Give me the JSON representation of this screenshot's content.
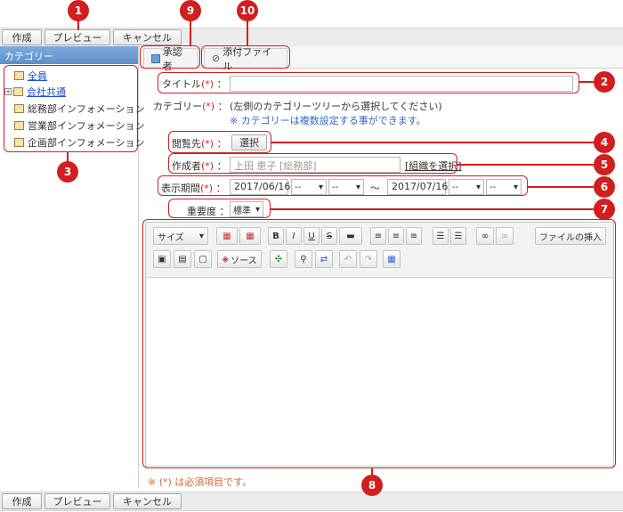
{
  "toolbar": {
    "create_label": "作成",
    "preview_label": "プレビュー",
    "cancel_label": "キャンセル"
  },
  "sidebar": {
    "header": "カテゴリー",
    "items": [
      {
        "label": "全員",
        "link": true,
        "expandable": false
      },
      {
        "label": "会社共通",
        "link": true,
        "expandable": true
      },
      {
        "label": "総務部インフォメーション",
        "link": false,
        "expandable": false
      },
      {
        "label": "営業部インフォメーション",
        "link": false,
        "expandable": false
      },
      {
        "label": "企画部インフォメーション",
        "link": false,
        "expandable": false
      }
    ]
  },
  "tabs": [
    {
      "label": "承認者"
    },
    {
      "label": "添付ファイル"
    }
  ],
  "form": {
    "required_mark": "(*)",
    "colon": "：",
    "title_label": "タイトル",
    "title_value": "",
    "category_label": "カテゴリー",
    "category_value": "(左側のカテゴリーツリーから選択してください)",
    "category_hint": "※ カテゴリーは複数設定する事ができます。",
    "viewers_label": "閲覧先",
    "viewers_button": "選択",
    "author_label": "作成者",
    "author_value": "上田 恵子 [総務部]",
    "author_link": "[組織を選択]",
    "period_label": "表示期間",
    "start_date": "2017/06/16",
    "end_date": "2017/07/16",
    "time_placeholder": "--",
    "period_sep": "～",
    "importance_label": "重要度",
    "importance_value": "標準",
    "required_note": "※ (*) は必須項目です。"
  },
  "editor": {
    "size_label": "サイズ",
    "insert_file_label": "ファイルの挿入",
    "source_label": "ソース"
  },
  "markers": [
    "1",
    "2",
    "3",
    "4",
    "5",
    "6",
    "7",
    "8",
    "9",
    "10"
  ],
  "colors": {
    "accent_red": "#d11e1e",
    "link_blue": "#1a4fd8",
    "header_blue": "#5d8fcc"
  }
}
